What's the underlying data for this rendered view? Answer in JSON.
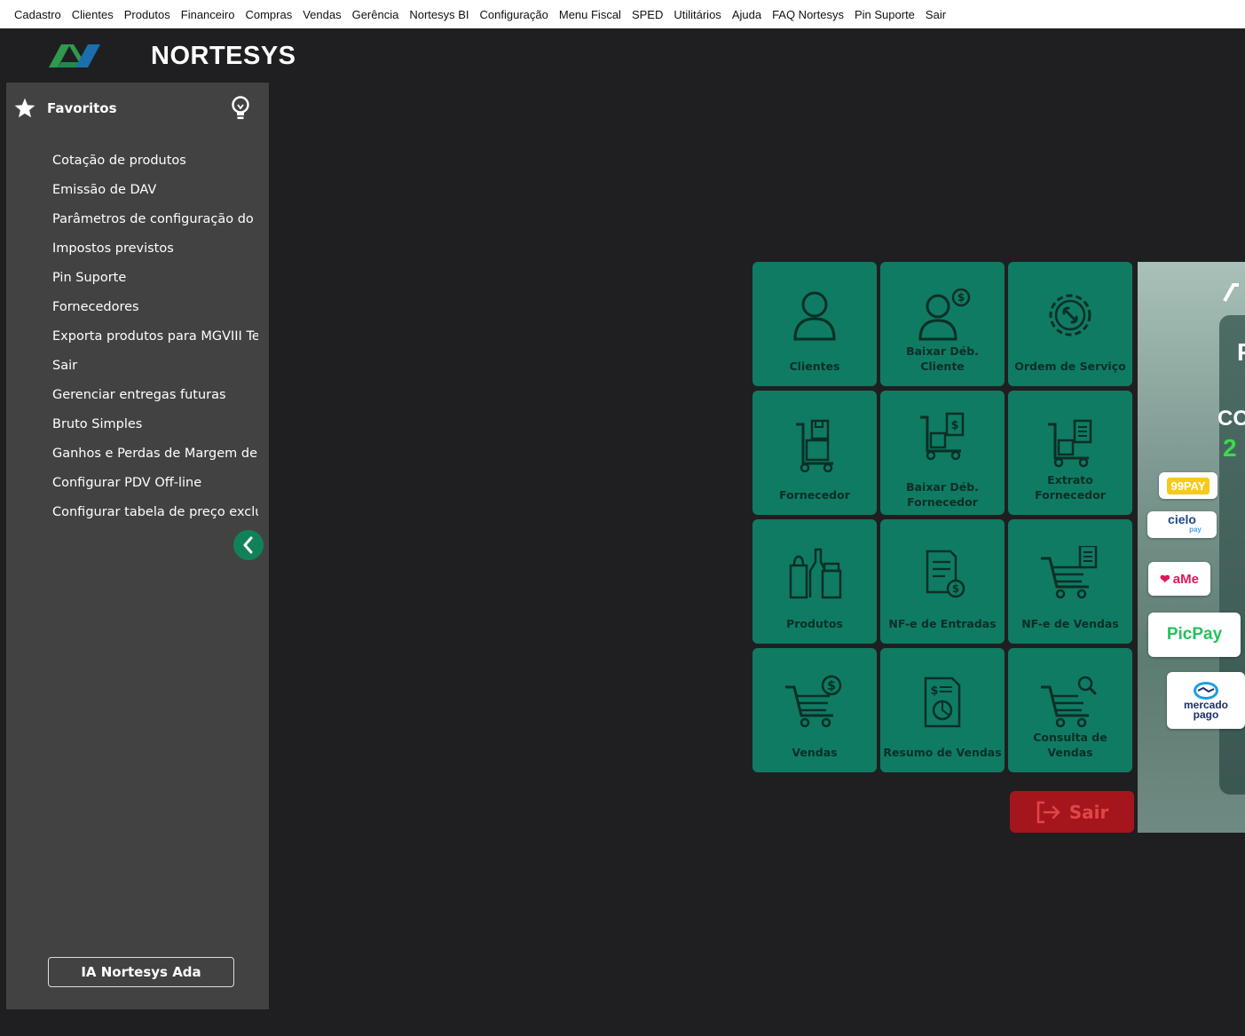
{
  "menubar": {
    "items": [
      "Cadastro",
      "Clientes",
      "Produtos",
      "Financeiro",
      "Compras",
      "Vendas",
      "Gerência",
      "Nortesys BI",
      "Configuração",
      "Menu Fiscal",
      "SPED",
      "Utilitários",
      "Ajuda",
      "FAQ Nortesys",
      "Pin Suporte",
      "Sair"
    ]
  },
  "brand": {
    "name": "NORTESYS"
  },
  "sidebar": {
    "title": "Favoritos",
    "items": [
      "Cotação de produtos",
      "Emissão de DAV",
      "Parâmetros de configuração do",
      "Impostos previstos",
      "Pin Suporte",
      "Fornecedores",
      "Exporta produtos para MGVIII Te",
      "Sair",
      "Gerenciar entregas futuras",
      "Bruto Simples",
      "Ganhos e Perdas de Margem de",
      "Configurar PDV Off-line",
      "Configurar tabela de preço exclu"
    ],
    "ai_button": "IA Nortesys Ada"
  },
  "tiles": [
    {
      "label": "Clientes",
      "icon": "person-icon"
    },
    {
      "label": "Baixar Déb. Cliente",
      "icon": "person-dollar-icon"
    },
    {
      "label": "Ordem de Serviço",
      "icon": "gear-wrench-icon"
    },
    {
      "label": "Fornecedor",
      "icon": "hand-truck-box-icon"
    },
    {
      "label": "Baixar Déb. Fornecedor",
      "icon": "hand-truck-dollar-icon"
    },
    {
      "label": "Extrato Fornecedor",
      "icon": "hand-truck-list-icon"
    },
    {
      "label": "Produtos",
      "icon": "bottles-icon"
    },
    {
      "label": "NF-e de Entradas",
      "icon": "invoice-dollar-icon"
    },
    {
      "label": "NF-e de Vendas",
      "icon": "cart-list-icon"
    },
    {
      "label": "Vendas",
      "icon": "cart-dollar-icon"
    },
    {
      "label": "Resumo de Vendas",
      "icon": "report-chart-icon"
    },
    {
      "label": "Consulta de Vendas",
      "icon": "cart-search-icon"
    }
  ],
  "exit_button": {
    "label": "Sair"
  },
  "banner": {
    "text_a": "P",
    "text_b": "CO",
    "text_c": "2",
    "payments": [
      "99PAY",
      "cielo",
      "pay",
      "aMe",
      "PicPay",
      "mercado",
      "pago"
    ]
  },
  "colors": {
    "background": "#1f1f21",
    "sidebar": "#424242",
    "tile": "#0f7b63",
    "tile_text": "#0b2f26",
    "accent_green": "#118257",
    "exit": "#a4161b"
  }
}
